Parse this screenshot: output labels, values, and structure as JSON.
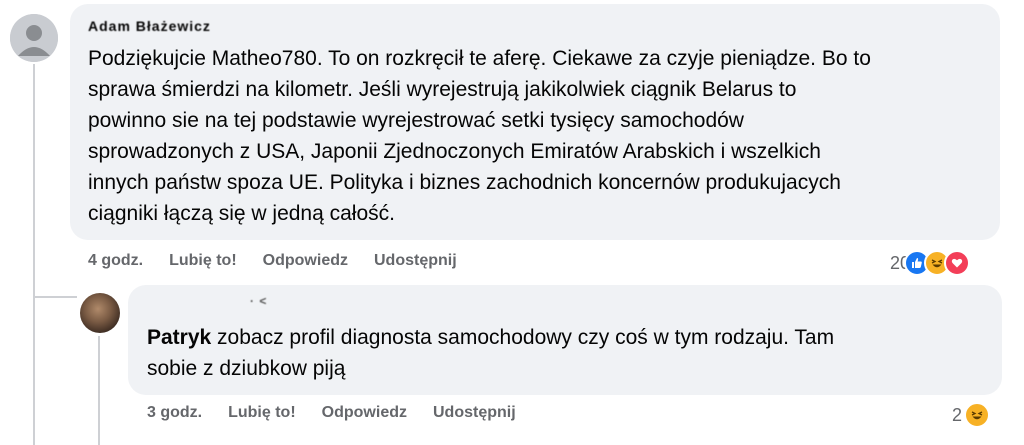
{
  "comments": [
    {
      "author": "Adam Błażewicz",
      "text": "Podziękujcie Matheo780. To on rozkręcił te aferę. Ciekawe za czyje pieniądze. Bo to\nsprawa śmierdzi na kilometr. Jeśli wyrejestrują jakikolwiek ciągnik Belarus to\npowinno sie na tej podstawie wyrejestrować setki tysięcy samochodów\nsprowadzonych z USA, Japonii Zjednoczonych Emiratów Arabskich i wszelkich\ninnych państw spoza UE. Polityka i biznes zachodnich koncernów produkujacych\nciągniki łączą się w jedną całość.",
      "time": "4 godz.",
      "like_label": "Lubię to!",
      "reply_label": "Odpowiedz",
      "share_label": "Udostępnij",
      "reaction_count": "20",
      "reactions": [
        "like-icon",
        "haha-icon",
        "love-icon"
      ]
    },
    {
      "author": "·  ˂",
      "mention": "Patryk",
      "text": " zobacz profil diagnosta samochodowy czy coś w tym rodzaju. Tam\nsobie z dziubkow piją",
      "time": "3 godz.",
      "like_label": "Lubię to!",
      "reply_label": "Odpowiedz",
      "share_label": "Udostępnij",
      "reaction_count": "2",
      "reactions": [
        "haha-icon"
      ]
    }
  ],
  "colors": {
    "bubble": "#f0f2f5",
    "meta": "#65676b",
    "like": "#1877f2",
    "haha": "#f7b125",
    "love": "#f33e58"
  }
}
